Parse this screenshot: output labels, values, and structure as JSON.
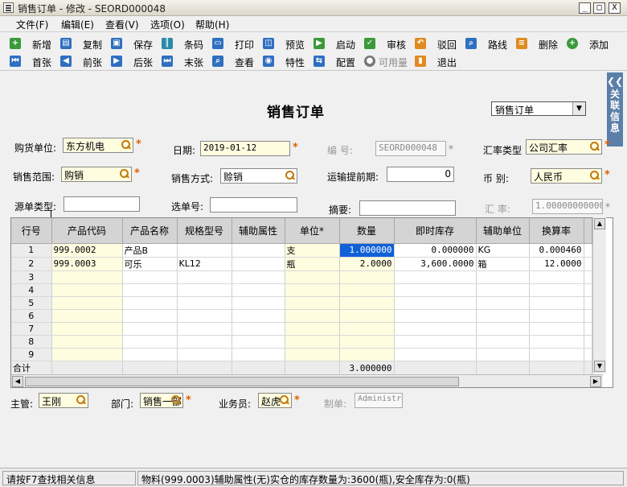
{
  "window": {
    "title": "销售订单 - 修改 - SEORD000048",
    "min": "_",
    "max": "□",
    "close": "X"
  },
  "menu": [
    "文件(F)",
    "编辑(E)",
    "查看(V)",
    "选项(O)",
    "帮助(H)"
  ],
  "toolbar": {
    "row1": [
      "新增",
      "复制",
      "保存",
      "条码",
      "打印",
      "预览",
      "启动",
      "审核",
      "驳回",
      "路线",
      "删除",
      "添加"
    ],
    "row2": [
      "首张",
      "前张",
      "后张",
      "末张",
      "查看",
      "特性",
      "配置",
      "可用量",
      "退出"
    ]
  },
  "side_tab": "关联信息",
  "form": {
    "title": "销售订单",
    "type_select": "销售订单",
    "buyer_label": "购货单位:",
    "buyer": "东方机电",
    "date_label": "日期:",
    "date": "2019-01-12",
    "number_label": "编    号:",
    "number": "SEORD000048",
    "rate_type_label": "汇率类型",
    "rate_type": "公司汇率",
    "scope_label": "销售范围:",
    "scope": "购销",
    "method_label": "销售方式:",
    "method": "赊销",
    "lead_label": "运输提前期:",
    "lead": "0",
    "currency_label": "币    别:",
    "currency": "人民币",
    "source_label": "源单类型:",
    "source": "",
    "pick_label": "选单号:",
    "pick": "",
    "summary_label": "摘要:",
    "summary": "",
    "rate_label": "汇    率:",
    "rate": "1.0000000000000",
    "manager_label": "主管:",
    "manager": "王刚",
    "dept_label": "部门:",
    "dept": "销售一部",
    "sales_label": "业务员:",
    "sales": "赵虎",
    "maker_label": "制单:",
    "maker": "Administrator"
  },
  "grid": {
    "headers": [
      "行号",
      "产品代码",
      "产品名称",
      "规格型号",
      "辅助属性",
      "单位*",
      "数量",
      "即时库存",
      "辅助单位",
      "换算率"
    ],
    "rows": [
      [
        "1",
        "999.0002",
        "产品B",
        "",
        "",
        "支",
        "1.000000",
        "0.000000",
        "KG",
        "0.000460"
      ],
      [
        "2",
        "999.0003",
        "可乐",
        "KL12",
        "",
        "瓶",
        "2.0000",
        "3,600.0000",
        "箱",
        "12.0000"
      ],
      [
        "3",
        "",
        "",
        "",
        "",
        "",
        "",
        "",
        "",
        ""
      ],
      [
        "4",
        "",
        "",
        "",
        "",
        "",
        "",
        "",
        "",
        ""
      ],
      [
        "5",
        "",
        "",
        "",
        "",
        "",
        "",
        "",
        "",
        ""
      ],
      [
        "6",
        "",
        "",
        "",
        "",
        "",
        "",
        "",
        "",
        ""
      ],
      [
        "7",
        "",
        "",
        "",
        "",
        "",
        "",
        "",
        "",
        ""
      ],
      [
        "8",
        "",
        "",
        "",
        "",
        "",
        "",
        "",
        "",
        ""
      ],
      [
        "9",
        "",
        "",
        "",
        "",
        "",
        "",
        "",
        "",
        ""
      ]
    ],
    "total_label": "合计",
    "total_qty": "3.000000"
  },
  "status": {
    "left": "请按F7查找相关信息",
    "right": "物料(999.0003)辅助属性(无)实仓的库存数量为:3600(瓶),安全库存为:0(瓶)"
  },
  "colors": {
    "accent": "#1060d8",
    "required": "#e06000",
    "field_yellow": "#fffde0",
    "side_tab": "#5a7fa8"
  }
}
